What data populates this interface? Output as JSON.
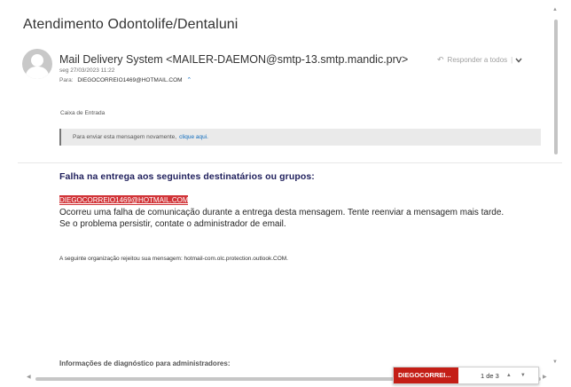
{
  "message": {
    "subject": "Atendimento Odontolife/Dentaluni",
    "sender": "Mail Delivery System <MAILER-DAEMON@smtp-13.smtp.mandic.prv>",
    "date": "seg 27/03/2023 11:22",
    "to_label": "Para:",
    "to_address": "DIEGOCORREIO1469@HOTMAIL.COM",
    "to_caret": "⌃",
    "reply_all_label": "Responder a todos",
    "reply_icon": "↶",
    "reply_separator": "|",
    "reply_chevron": "⌄"
  },
  "body": {
    "folder": "Caixa de Entrada",
    "resend_banner_text": "Para enviar esta mensagem novamente,",
    "resend_banner_link": "clique aqui.",
    "failure_title": "Falha na entrega aos seguintes destinatários ou grupos:",
    "failed_recipient": "DIEGOCORREIO1469@HOTMAIL.COM",
    "failure_line1": "Ocorreu uma falha de comunicação durante a entrega desta mensagem. Tente reenviar a mensagem mais tarde.",
    "failure_line2": "Se o problema persistir, contate o administrador de email.",
    "rejection_line": "A seguinte organização rejeitou sua mensagem: hotmail-com.olc.protection.outlook.COM.",
    "diagnostics_title": "Informações de diagnóstico para administradores:"
  },
  "find_bar": {
    "search_term": "DIEGOCORREI...",
    "match_count": "1 de 3",
    "prev_symbol": "▲",
    "next_symbol": "▼"
  },
  "scroll": {
    "up_symbol": "▲",
    "down_symbol": "▼",
    "left_symbol": "◀",
    "right_symbol": "▶"
  },
  "colors": {
    "highlight_red": "#d13438",
    "find_red": "#c41e16",
    "link_blue": "#0f6cbd",
    "title_navy": "#1f1f5c"
  }
}
